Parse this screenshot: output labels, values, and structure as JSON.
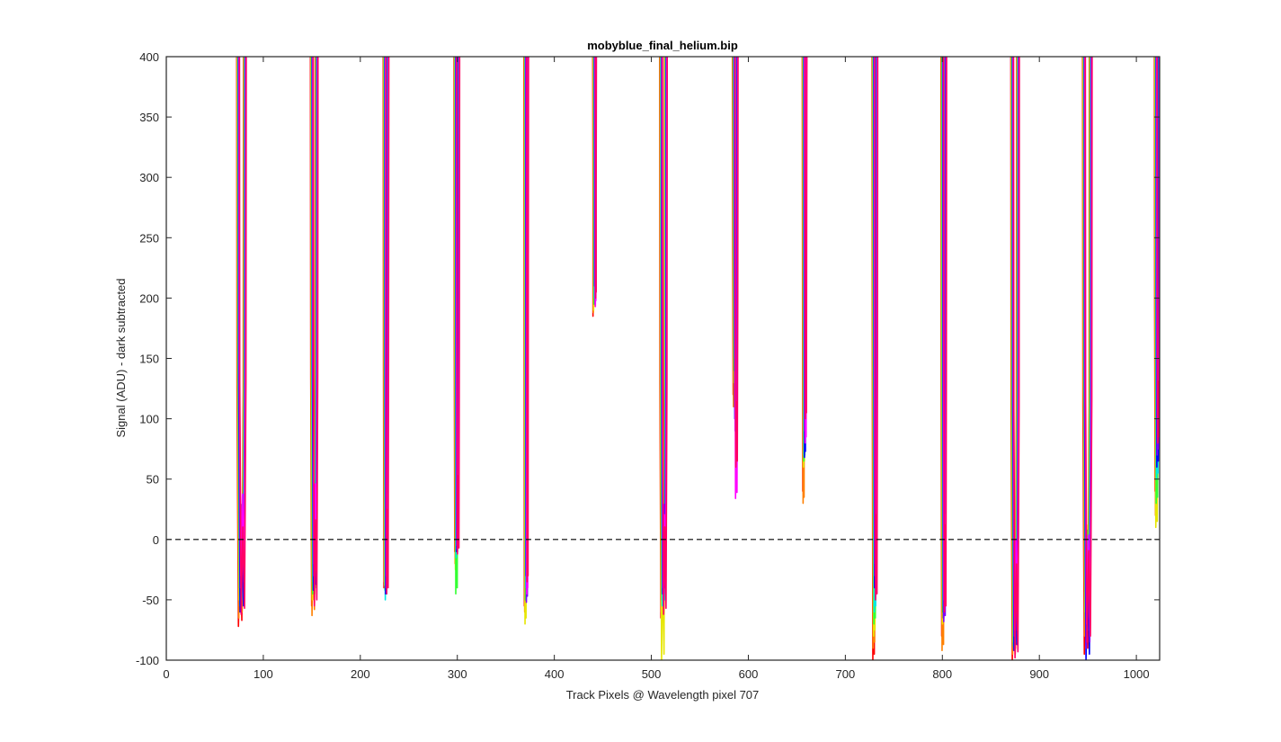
{
  "chart_data": {
    "type": "line",
    "title": "mobyblue_final_helium.bip",
    "xlabel": "Track Pixels @ Wavelength pixel 707",
    "ylabel": "Signal (ADU) - dark subtracted",
    "xlim": [
      0,
      1024
    ],
    "ylim": [
      -100,
      400
    ],
    "xticks": [
      0,
      100,
      200,
      300,
      400,
      500,
      600,
      700,
      800,
      900,
      1000
    ],
    "yticks": [
      -100,
      -50,
      0,
      50,
      100,
      150,
      200,
      250,
      300,
      350,
      400
    ],
    "xtick_labels": [
      "0",
      "100",
      "200",
      "300",
      "400",
      "500",
      "600",
      "700",
      "800",
      "900",
      "1000"
    ],
    "ytick_labels": [
      "-100",
      "-50",
      "0",
      "50",
      "100",
      "150",
      "200",
      "250",
      "300",
      "350",
      "400"
    ],
    "grid": false,
    "reference_line": {
      "y": 0,
      "style": "dashed",
      "color": "#000000"
    },
    "series_colors": [
      "#ff0000",
      "#ff8000",
      "#e6e600",
      "#33ff33",
      "#00e6e6",
      "#0000ff",
      "#8000ff",
      "#ff00ff",
      "#ff0066"
    ],
    "dips": [
      {
        "x1": 74,
        "x2": 81,
        "mins": [
          -72,
          -65,
          -50,
          -40,
          -55,
          -60,
          -40,
          -30,
          -62
        ]
      },
      {
        "x1": 150,
        "x2": 155,
        "mins": [
          -55,
          -63,
          -50,
          -45,
          -35,
          -42,
          -30,
          -20,
          -55
        ]
      },
      {
        "x1": 225,
        "x2": 228,
        "mins": [
          -40,
          -35,
          -38,
          -42,
          -50,
          -45,
          -40,
          -30,
          -45
        ]
      },
      {
        "x1": 298,
        "x2": 301,
        "mins": [
          -10,
          -20,
          -25,
          -45,
          -15,
          -10,
          -5,
          -8,
          -12
        ]
      },
      {
        "x1": 370,
        "x2": 372,
        "mins": [
          -55,
          -60,
          -70,
          -50,
          -40,
          -30,
          -52,
          -45,
          -35
        ]
      },
      {
        "x1": 441,
        "x2": 442,
        "mins": [
          185,
          188,
          190,
          195,
          200,
          210,
          195,
          193,
          200
        ]
      },
      {
        "x1": 510,
        "x2": 515,
        "mins": [
          -65,
          -60,
          -100,
          -50,
          -55,
          -45,
          -40,
          -50,
          -62
        ]
      },
      {
        "x1": 585,
        "x2": 588,
        "mins": [
          120,
          110,
          130,
          140,
          150,
          100,
          90,
          34,
          60
        ]
      },
      {
        "x1": 657,
        "x2": 659,
        "mins": [
          40,
          30,
          60,
          65,
          70,
          68,
          90,
          80,
          100
        ]
      },
      {
        "x1": 729,
        "x2": 732,
        "mins": [
          -100,
          -90,
          -80,
          -70,
          -60,
          -40,
          -30,
          -20,
          -50
        ]
      },
      {
        "x1": 800,
        "x2": 803,
        "mins": [
          -80,
          -92,
          -70,
          -60,
          -55,
          -65,
          -68,
          -50,
          -60
        ]
      },
      {
        "x1": 872,
        "x2": 878,
        "mins": [
          -100,
          -95,
          -85,
          -88,
          -90,
          -92,
          -80,
          -75,
          -98
        ]
      },
      {
        "x1": 946,
        "x2": 953,
        "mins": [
          -95,
          -80,
          -60,
          -65,
          -75,
          -100,
          -90,
          -70,
          -85
        ]
      },
      {
        "x1": 1020,
        "x2": 1023,
        "mins": [
          40,
          20,
          10,
          30,
          50,
          60,
          70,
          100,
          80
        ]
      }
    ]
  }
}
